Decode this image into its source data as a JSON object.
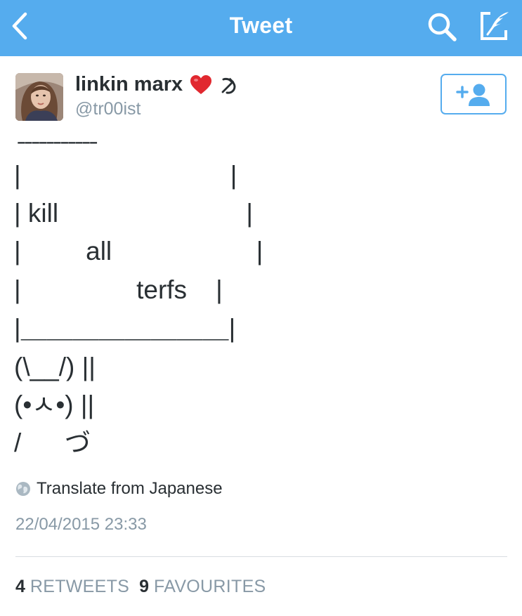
{
  "nav": {
    "title": "Tweet",
    "back_icon": "chevron-left-icon",
    "search_icon": "search-icon",
    "compose_icon": "compose-icon",
    "bar_color": "#55acee"
  },
  "author": {
    "display_name": "linkin marx",
    "handle": "@tr00ist",
    "name_emojis": [
      "heart-icon",
      "hammer-sickle-icon"
    ],
    "follow_icon": "add-user-icon"
  },
  "tweet": {
    "lines": [
      " ̄ ̄ ̄ ̄ ̄ ̄ ̄ ̄ ̄ ̄ ̄",
      "|                             |",
      "| kill                          |",
      "|         all                    |",
      "|                terfs    |",
      "|＿＿＿＿＿＿＿＿|",
      "(\\__/) ||",
      "(•ㅅ•) ||",
      "/      づ"
    ],
    "translate_label": "Translate from Japanese",
    "timestamp": "22/04/2015 23:33"
  },
  "stats": {
    "retweets_count": "4",
    "retweets_label": "RETWEETS",
    "favourites_count": "9",
    "favourites_label": "FAVOURITES"
  },
  "colors": {
    "accent": "#55acee",
    "muted_text": "#8899a6",
    "body_text": "#292f33",
    "divider": "#d8dde1"
  }
}
